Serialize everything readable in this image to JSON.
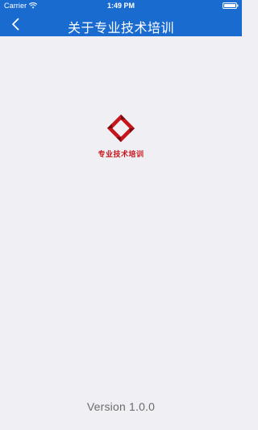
{
  "status_bar": {
    "carrier": "Carrier",
    "time": "1:49 PM",
    "wifi_icon": "wifi-icon",
    "battery_icon": "battery-icon"
  },
  "nav": {
    "title": "关于专业技术培训",
    "back_icon": "chevron-left-icon"
  },
  "logo": {
    "text": "专业技术培训",
    "color": "#c8151c"
  },
  "footer": {
    "version": "Version 1.0.0"
  },
  "colors": {
    "nav_background": "#1a6bd0",
    "page_background": "#efeff4"
  }
}
